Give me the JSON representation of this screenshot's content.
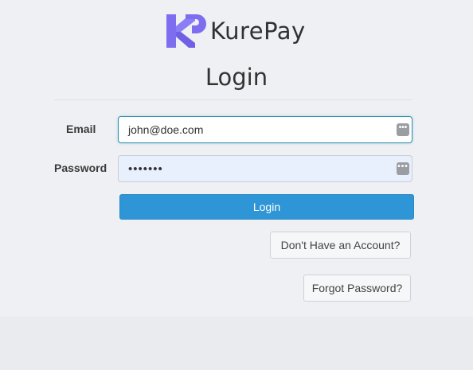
{
  "brand": {
    "name": "KurePay",
    "logo_color": "#7d6ef0"
  },
  "page": {
    "title": "Login"
  },
  "form": {
    "email_label": "Email",
    "email_value": "john@doe.com",
    "password_label": "Password",
    "password_value": "•••••••",
    "field_icon": "password-manager-icon",
    "login_button": "Login",
    "register_link": "Don't Have an Account?",
    "forgot_link": "Forgot Password?"
  },
  "colors": {
    "primary_button": "#2e95d6",
    "focus_border": "#2c8fb0",
    "autofill_background": "#e8f0fe"
  }
}
